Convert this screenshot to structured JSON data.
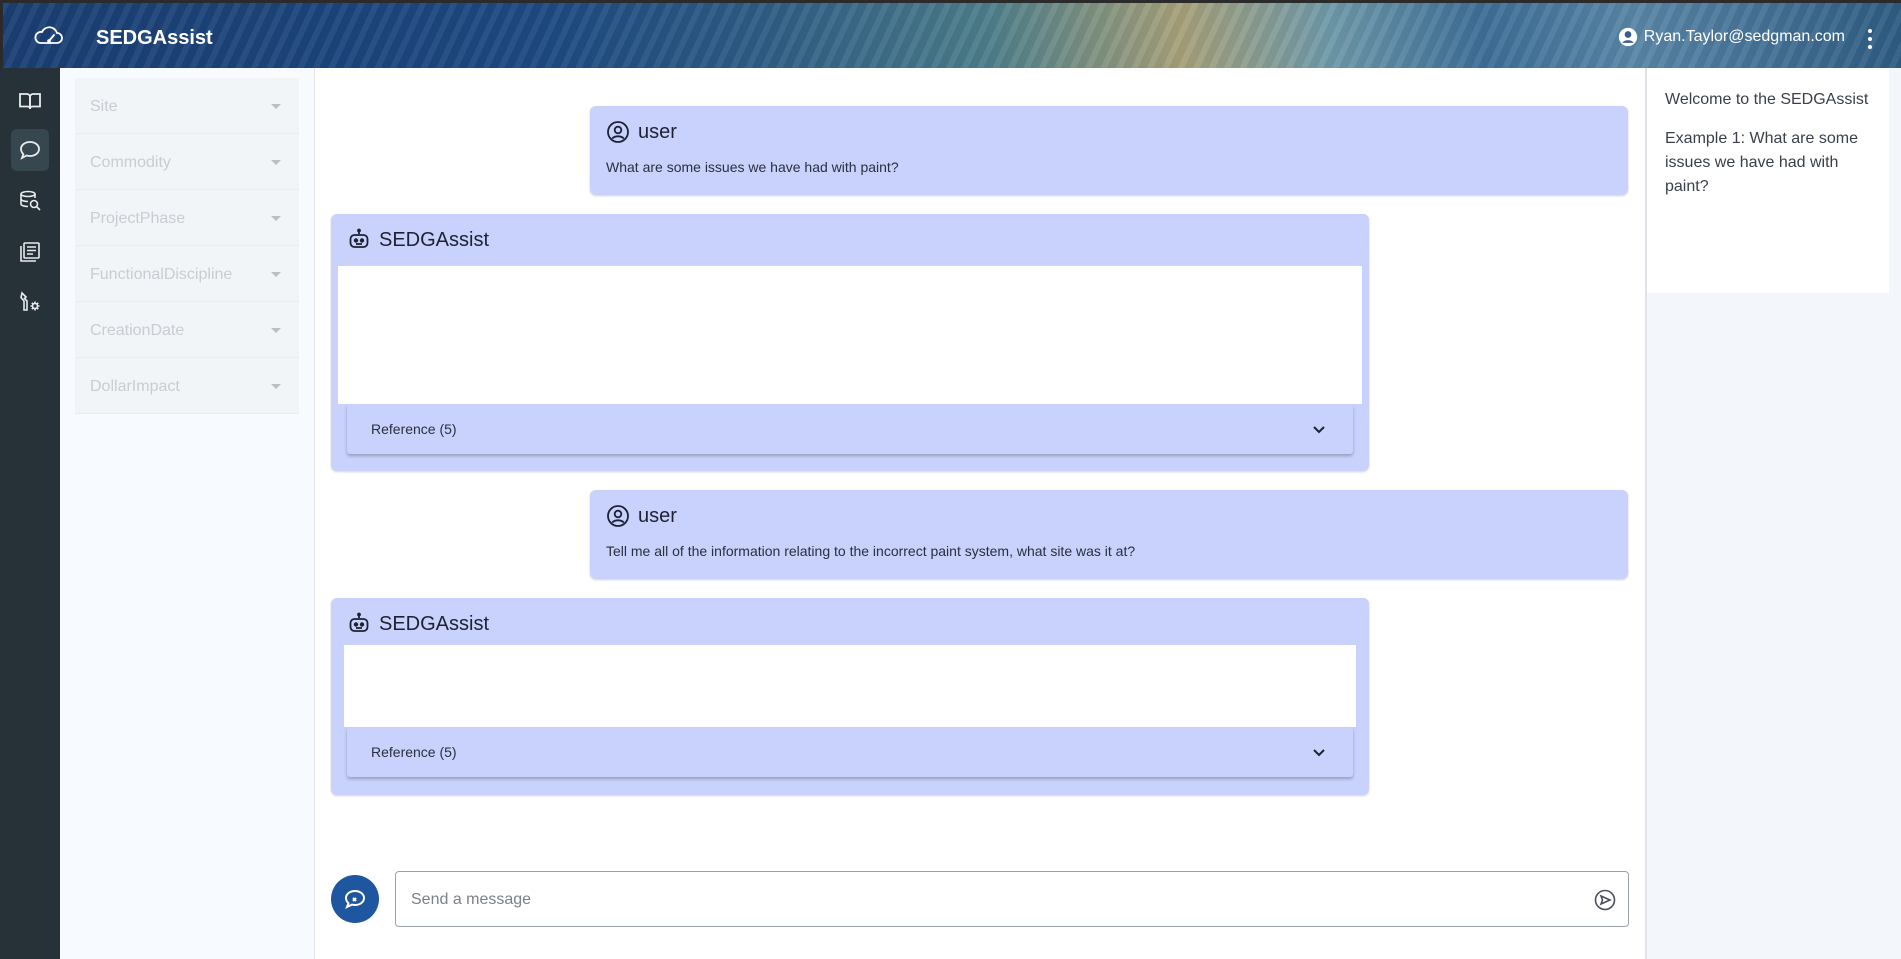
{
  "header": {
    "app_title": "SEDGAssist",
    "user_email": "Ryan.Taylor@sedgman.com"
  },
  "rail": {
    "items": [
      {
        "icon": "book-open-icon",
        "active": false
      },
      {
        "icon": "chat-bubble-icon",
        "active": true
      },
      {
        "icon": "database-search-icon",
        "active": false
      },
      {
        "icon": "library-icon",
        "active": false
      },
      {
        "icon": "tools-settings-icon",
        "active": false
      }
    ]
  },
  "filters": {
    "items": [
      {
        "label": "Site"
      },
      {
        "label": "Commodity"
      },
      {
        "label": "ProjectPhase"
      },
      {
        "label": "FunctionalDiscipline"
      },
      {
        "label": "CreationDate"
      },
      {
        "label": "DollarImpact"
      }
    ]
  },
  "chat": {
    "messages": [
      {
        "role": "user",
        "author": "user",
        "text": "What are some issues we have had with paint?"
      },
      {
        "role": "assistant",
        "author": "SEDGAssist",
        "reference_label": "Reference (5)"
      },
      {
        "role": "user",
        "author": "user",
        "text": "Tell me all of the information relating to the incorrect paint system, what site was it at?"
      },
      {
        "role": "assistant",
        "author": "SEDGAssist",
        "reference_label": "Reference (5)"
      }
    ],
    "input": {
      "placeholder": "Send a message",
      "value": ""
    }
  },
  "help_panel": {
    "welcome": "Welcome to the SEDGAssist",
    "example_1": "Example 1: What are some issues we have had with paint?"
  },
  "colors": {
    "bubble": "#c8d2fc",
    "rail": "#263238",
    "primary": "#1e56a0"
  }
}
